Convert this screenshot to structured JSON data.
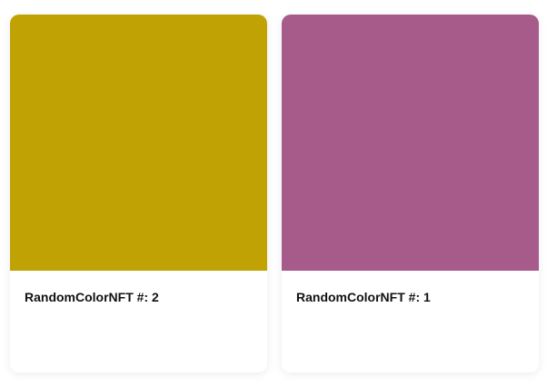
{
  "cards": [
    {
      "title": "RandomColorNFT #: 2",
      "color": "#C1A204"
    },
    {
      "title": "RandomColorNFT #: 1",
      "color": "#A65B8A"
    }
  ]
}
